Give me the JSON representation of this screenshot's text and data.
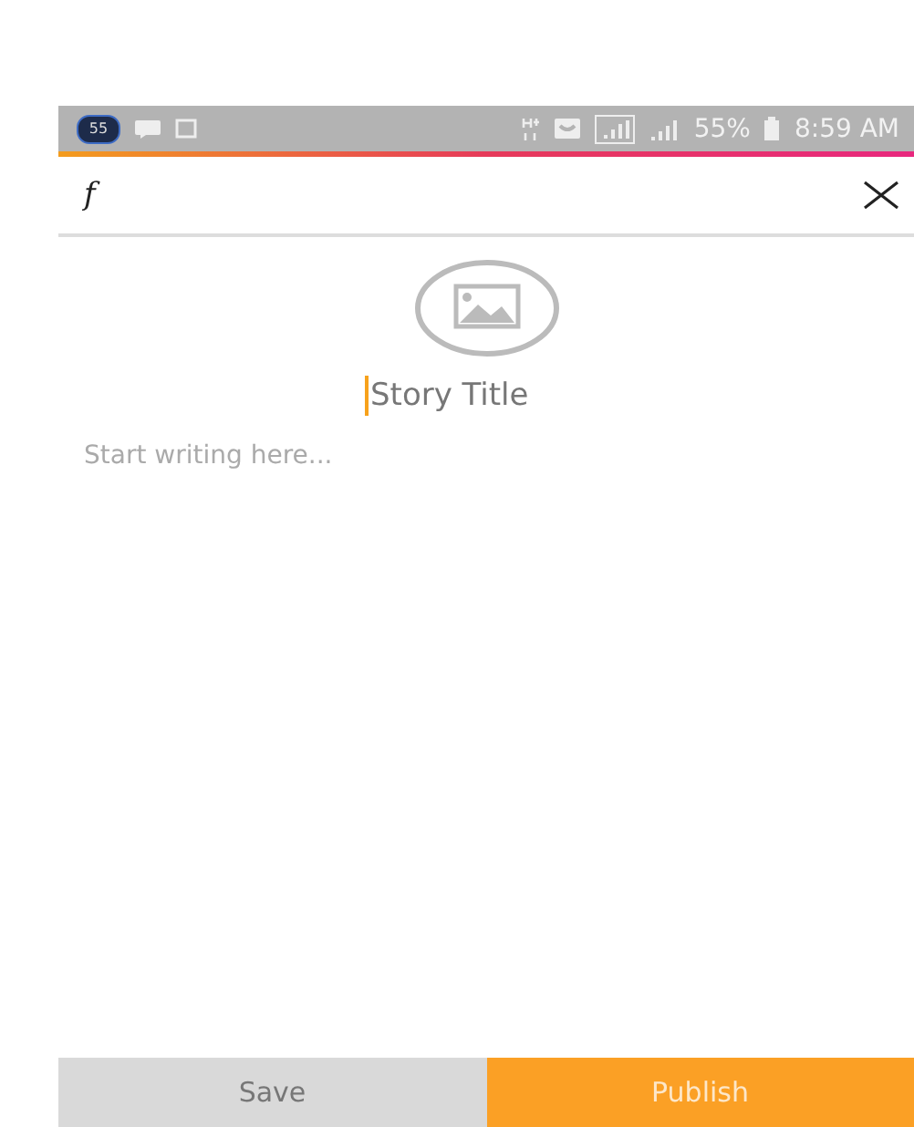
{
  "status_bar": {
    "badge": "55",
    "battery": "55%",
    "time": "8:59 AM"
  },
  "toolbar": {
    "format_label": "f"
  },
  "editor": {
    "title": {
      "placeholder": "Story Title"
    },
    "body": {
      "placeholder": "Start writing here..."
    }
  },
  "buttons": [
    {
      "label": "Save",
      "kind": "secondary"
    },
    {
      "label": "Publish",
      "kind": "primary"
    }
  ]
}
